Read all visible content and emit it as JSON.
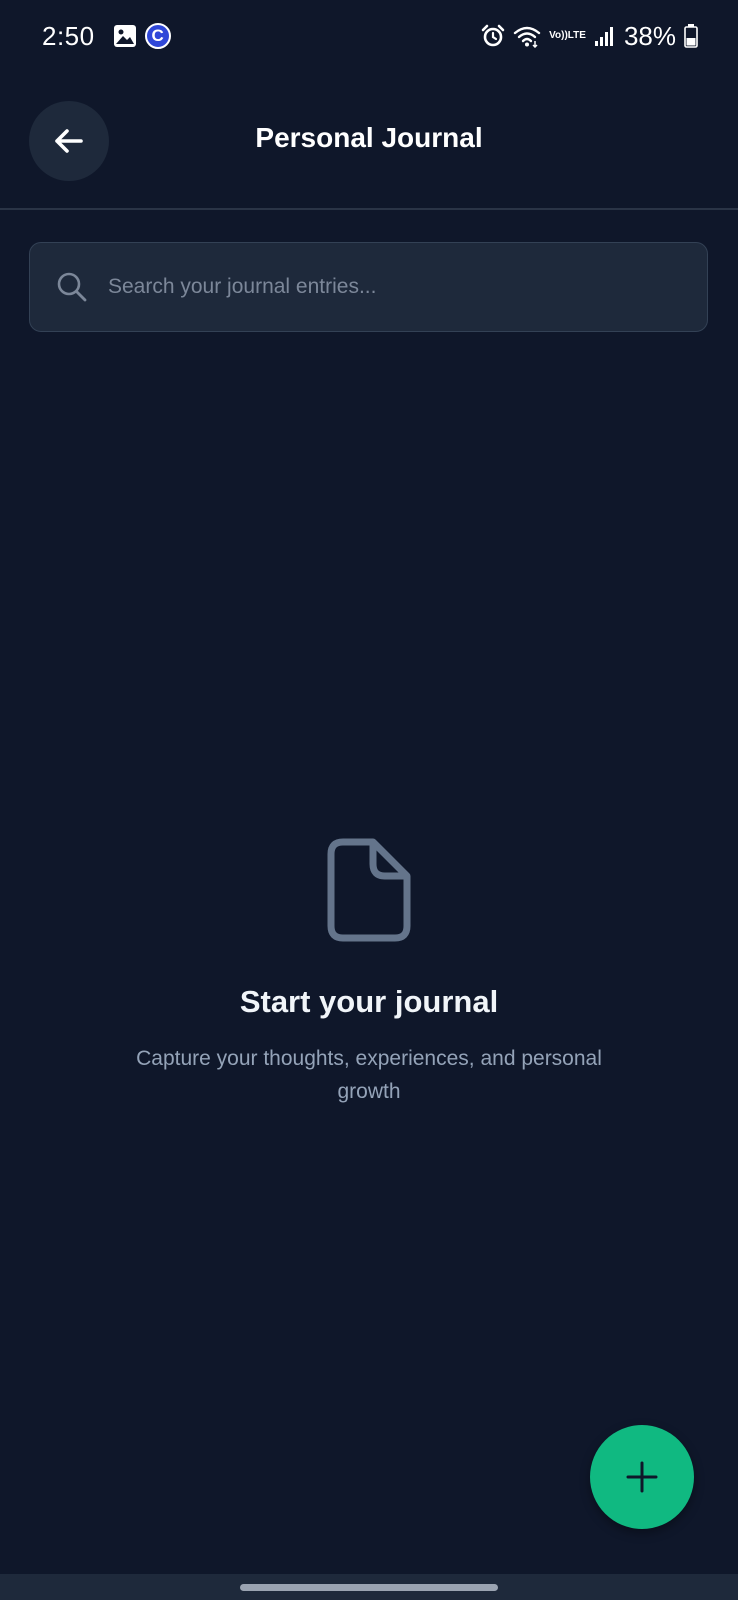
{
  "status_bar": {
    "time": "2:50",
    "notification_badge": "C",
    "network_label_top": "Vo))",
    "network_label_bottom": "LTE",
    "battery_percent": "38%"
  },
  "header": {
    "title": "Personal Journal",
    "back_icon": "arrow-left-icon"
  },
  "search": {
    "placeholder": "Search your journal entries...",
    "value": "",
    "icon": "search-icon"
  },
  "empty_state": {
    "icon": "document-icon",
    "title": "Start your journal",
    "description": "Capture your thoughts, experiences, and personal growth"
  },
  "fab": {
    "icon": "plus-icon"
  },
  "colors": {
    "background": "#0f172a",
    "surface": "#1e293b",
    "accent": "#10b981",
    "muted_text": "#94a3b8",
    "badge": "#2f47d8"
  }
}
